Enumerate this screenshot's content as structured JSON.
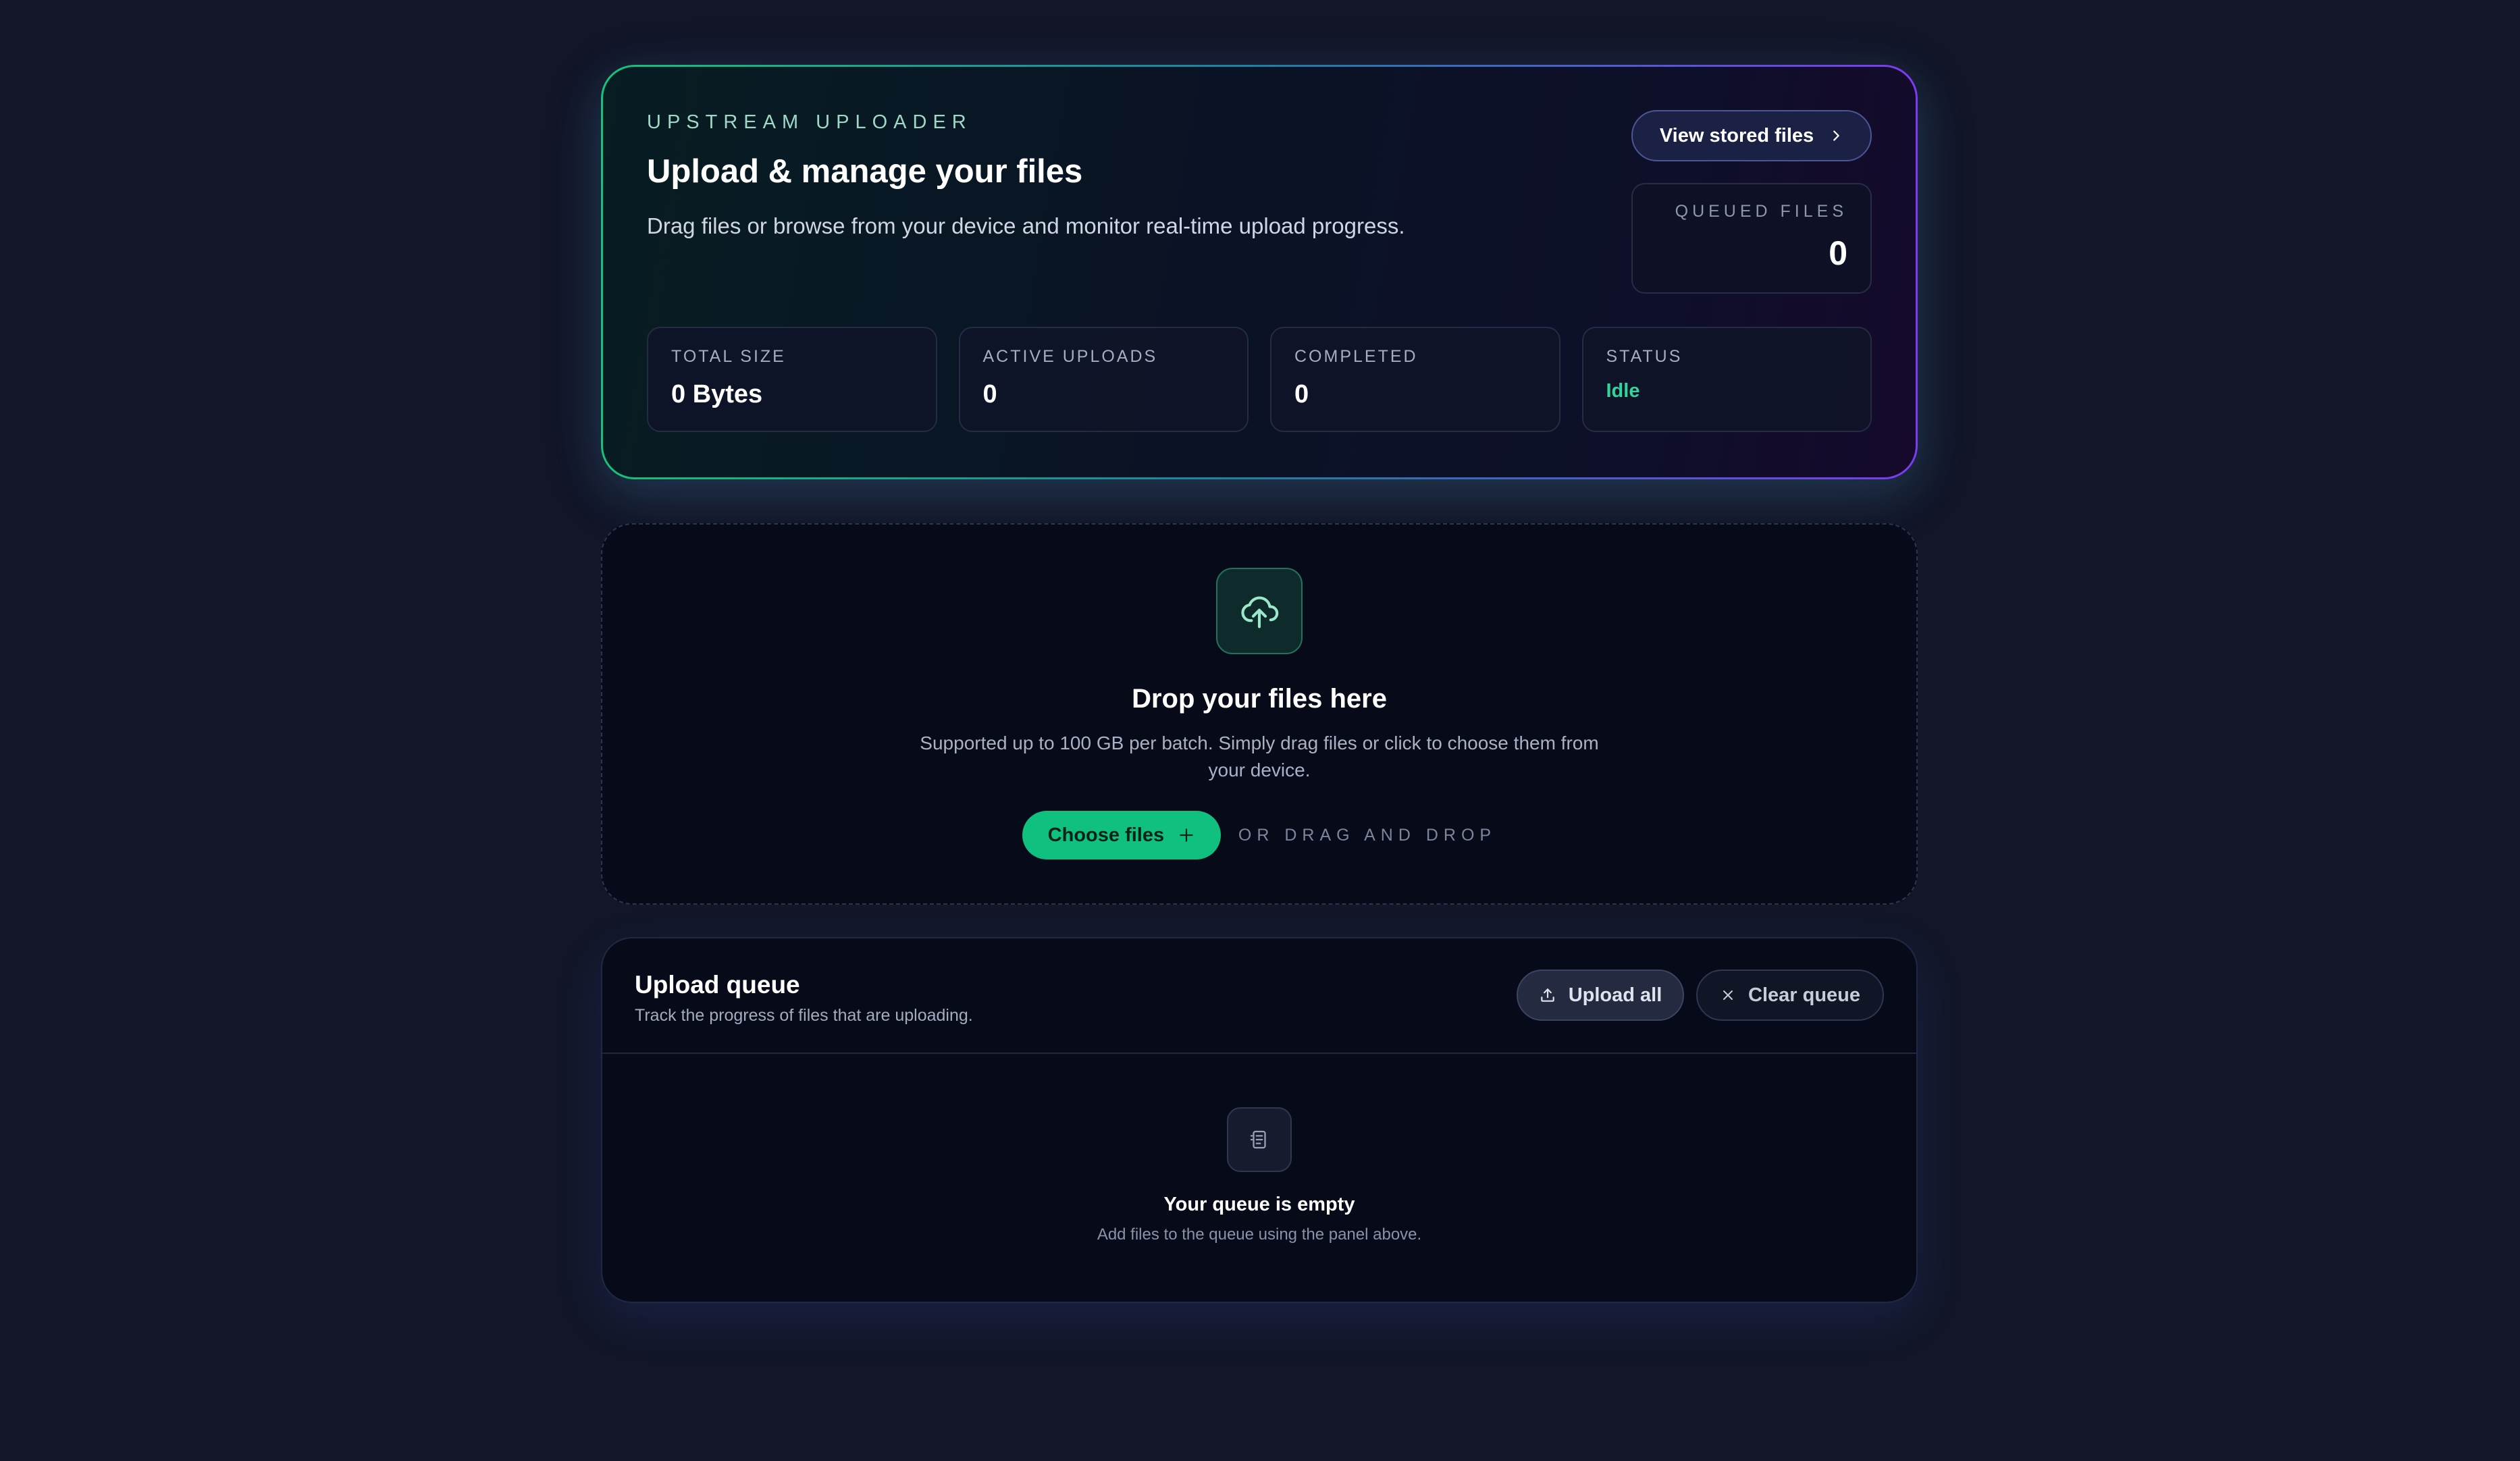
{
  "hero": {
    "eyebrow": "UPSTREAM UPLOADER",
    "title": "Upload & manage your files",
    "subtitle": "Drag files or browse from your device and monitor real-time upload progress.",
    "view_button": "View stored files",
    "queued": {
      "label": "QUEUED FILES",
      "value": "0"
    },
    "stats": [
      {
        "label": "TOTAL SIZE",
        "value": "0 Bytes"
      },
      {
        "label": "ACTIVE UPLOADS",
        "value": "0"
      },
      {
        "label": "COMPLETED",
        "value": "0"
      },
      {
        "label": "STATUS",
        "value": "Idle"
      }
    ]
  },
  "dropzone": {
    "title": "Drop your files here",
    "subtitle": "Supported up to 100 GB per batch. Simply drag files or click to choose them from your device.",
    "choose_button": "Choose files",
    "or_text": "OR DRAG AND DROP"
  },
  "queue": {
    "title": "Upload queue",
    "subtitle": "Track the progress of files that are uploading.",
    "upload_all": "Upload all",
    "clear_queue": "Clear queue",
    "empty_title": "Your queue is empty",
    "empty_subtitle": "Add files to the queue using the panel above."
  },
  "colors": {
    "accent_green": "#10c07f",
    "status_idle": "#34d399",
    "border_gradient_start": "#17c27a",
    "border_gradient_end": "#7b3cf0"
  },
  "icons": [
    "chevron-right-icon",
    "cloud-upload-icon",
    "plus-icon",
    "upload-icon",
    "close-icon",
    "list-icon"
  ]
}
